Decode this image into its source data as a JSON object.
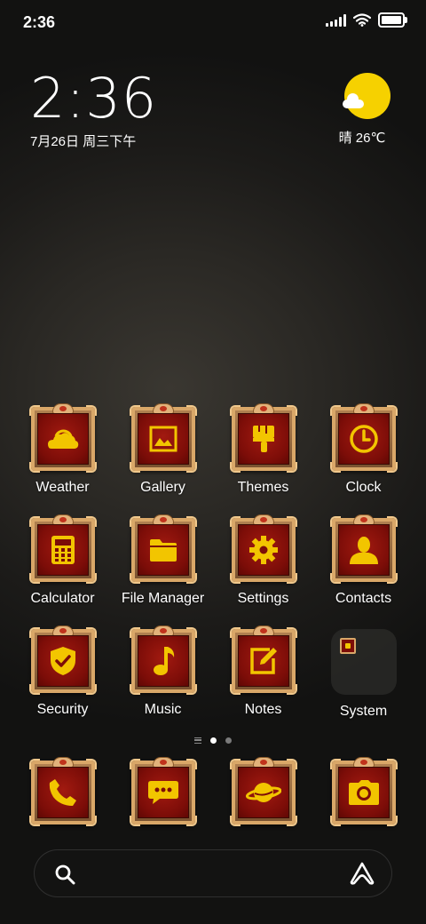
{
  "status_bar": {
    "time": "2:36",
    "signal_bars": 5,
    "icons": [
      "signal-icon",
      "wifi-icon",
      "battery-icon"
    ]
  },
  "clock_widget": {
    "time": "2:36",
    "date": "7月26日 周三下午"
  },
  "weather_widget": {
    "condition_icon": "sunny-icon",
    "text": "晴 26℃"
  },
  "apps": [
    {
      "label": "Weather",
      "icon": "weather-icon"
    },
    {
      "label": "Gallery",
      "icon": "gallery-icon"
    },
    {
      "label": "Themes",
      "icon": "brush-icon"
    },
    {
      "label": "Clock",
      "icon": "clock-icon"
    },
    {
      "label": "Calculator",
      "icon": "calculator-icon"
    },
    {
      "label": "File Manager",
      "icon": "folder-icon"
    },
    {
      "label": "Settings",
      "icon": "gear-icon"
    },
    {
      "label": "Contacts",
      "icon": "person-icon"
    },
    {
      "label": "Security",
      "icon": "shield-icon"
    },
    {
      "label": "Music",
      "icon": "music-note-icon"
    },
    {
      "label": "Notes",
      "icon": "pencil-note-icon"
    },
    {
      "label": "System",
      "icon": "folder-group-icon"
    }
  ],
  "page_indicator": {
    "pages": 2,
    "active_index": 0
  },
  "dock": [
    {
      "icon": "phone-icon"
    },
    {
      "icon": "message-icon"
    },
    {
      "icon": "planet-icon"
    },
    {
      "icon": "camera-icon"
    }
  ],
  "search_bar": {
    "search_icon": "search-icon",
    "assistant_icon": "assistant-icon"
  },
  "colors": {
    "icon_glyph": "#f2c500",
    "icon_bg": "#7c0d08",
    "frame_gold": "#d9a768",
    "sun": "#f6d100"
  }
}
